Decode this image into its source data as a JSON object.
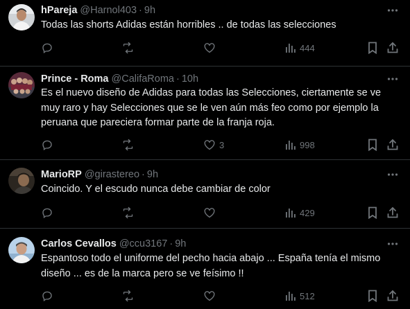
{
  "tweets": [
    {
      "name": "hPareja",
      "handle": "@Harnol403",
      "time": "9h",
      "text": "Todas las shorts Adidas están horribles .. de todas las selecciones",
      "replies": "",
      "retweets": "",
      "likes": "",
      "views": "444"
    },
    {
      "name": "Prince - Roma",
      "handle": "@CalifaRoma",
      "time": "10h",
      "text_lines": [
        "Es el nuevo diseño de Adidas para todas las Selecciones, ciertamente se ve",
        "muy raro y hay Selecciones que se le ven aún más feo como por ejemplo la",
        "peruana que pareciera formar parte de la franja roja."
      ],
      "replies": "",
      "retweets": "",
      "likes": "3",
      "views": "998"
    },
    {
      "name": "MarioRP",
      "handle": "@girastereo",
      "time": "9h",
      "text": "Coincido. Y el escudo nunca debe cambiar de color",
      "replies": "",
      "retweets": "",
      "likes": "",
      "views": "429"
    },
    {
      "name": "Carlos Cevallos",
      "handle": "@ccu3167",
      "time": "9h",
      "text_lines": [
        "Espantoso todo el uniforme del pecho hacia abajo ... España tenía el mismo",
        "diseño ... es de la marca pero se ve feísimo !!"
      ],
      "replies": "",
      "retweets": "",
      "likes": "",
      "views": "512"
    }
  ],
  "separator": "·",
  "colors": {
    "background": "#000000",
    "text": "#e7e9ea",
    "muted": "#71767b",
    "divider": "#2f3336"
  },
  "icons": [
    "more-icon",
    "reply-icon",
    "retweet-icon",
    "like-icon",
    "views-icon",
    "bookmark-icon",
    "share-icon"
  ]
}
